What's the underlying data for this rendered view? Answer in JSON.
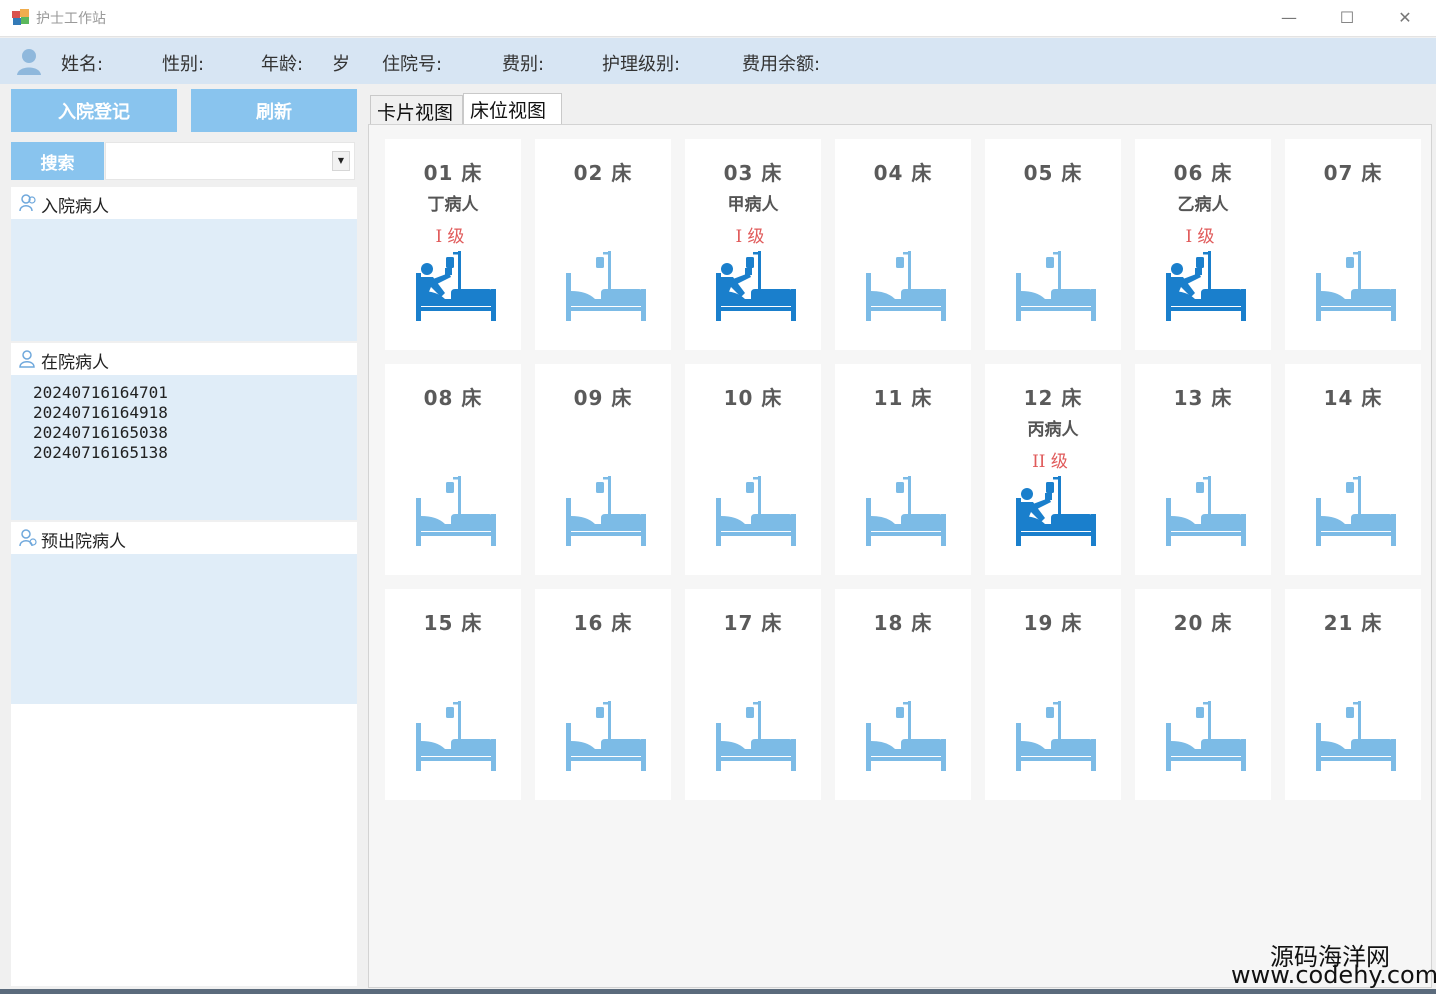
{
  "window": {
    "title": "护士工作站",
    "minimize": "—",
    "maximize": "☐",
    "close": "✕"
  },
  "infobar": {
    "name_label": "姓名:",
    "gender_label": "性别:",
    "age_label": "年龄:",
    "age_unit": "岁",
    "admission_label": "住院号:",
    "fee_type_label": "费别:",
    "care_level_label": "护理级别:",
    "balance_label": "费用余额:"
  },
  "left": {
    "admit_button": "入院登记",
    "refresh_button": "刷新",
    "search_button": "搜索",
    "search_value": "",
    "groups": {
      "admitting": {
        "title": "入院病人",
        "items": []
      },
      "inpatient": {
        "title": "在院病人",
        "items": [
          "20240716164701",
          "20240716164918",
          "20240716165038",
          "20240716165138"
        ]
      },
      "discharge": {
        "title": "预出院病人",
        "items": []
      }
    }
  },
  "tabs": [
    {
      "label": "卡片视图",
      "active": false
    },
    {
      "label": "床位视图",
      "active": true
    }
  ],
  "colors": {
    "occupied": "#1a7fcc",
    "empty": "#7cbbe6",
    "level": "#e05a5a",
    "button": "#89c4ee"
  },
  "beds": [
    {
      "no": "01 床",
      "patient": "丁病人",
      "level": "I 级",
      "occupied": true
    },
    {
      "no": "02 床",
      "patient": "",
      "level": "",
      "occupied": false
    },
    {
      "no": "03 床",
      "patient": "甲病人",
      "level": "I 级",
      "occupied": true
    },
    {
      "no": "04 床",
      "patient": "",
      "level": "",
      "occupied": false
    },
    {
      "no": "05 床",
      "patient": "",
      "level": "",
      "occupied": false
    },
    {
      "no": "06 床",
      "patient": "乙病人",
      "level": "I 级",
      "occupied": true
    },
    {
      "no": "07 床",
      "patient": "",
      "level": "",
      "occupied": false
    },
    {
      "no": "08 床",
      "patient": "",
      "level": "",
      "occupied": false
    },
    {
      "no": "09 床",
      "patient": "",
      "level": "",
      "occupied": false
    },
    {
      "no": "10 床",
      "patient": "",
      "level": "",
      "occupied": false
    },
    {
      "no": "11 床",
      "patient": "",
      "level": "",
      "occupied": false
    },
    {
      "no": "12 床",
      "patient": "丙病人",
      "level": "II 级",
      "occupied": true
    },
    {
      "no": "13 床",
      "patient": "",
      "level": "",
      "occupied": false
    },
    {
      "no": "14 床",
      "patient": "",
      "level": "",
      "occupied": false
    },
    {
      "no": "15 床",
      "patient": "",
      "level": "",
      "occupied": false
    },
    {
      "no": "16 床",
      "patient": "",
      "level": "",
      "occupied": false
    },
    {
      "no": "17 床",
      "patient": "",
      "level": "",
      "occupied": false
    },
    {
      "no": "18 床",
      "patient": "",
      "level": "",
      "occupied": false
    },
    {
      "no": "19 床",
      "patient": "",
      "level": "",
      "occupied": false
    },
    {
      "no": "20 床",
      "patient": "",
      "level": "",
      "occupied": false
    },
    {
      "no": "21 床",
      "patient": "",
      "level": "",
      "occupied": false
    }
  ],
  "watermark": {
    "line1": "源码海洋网",
    "line2": "www.codehy.com"
  }
}
